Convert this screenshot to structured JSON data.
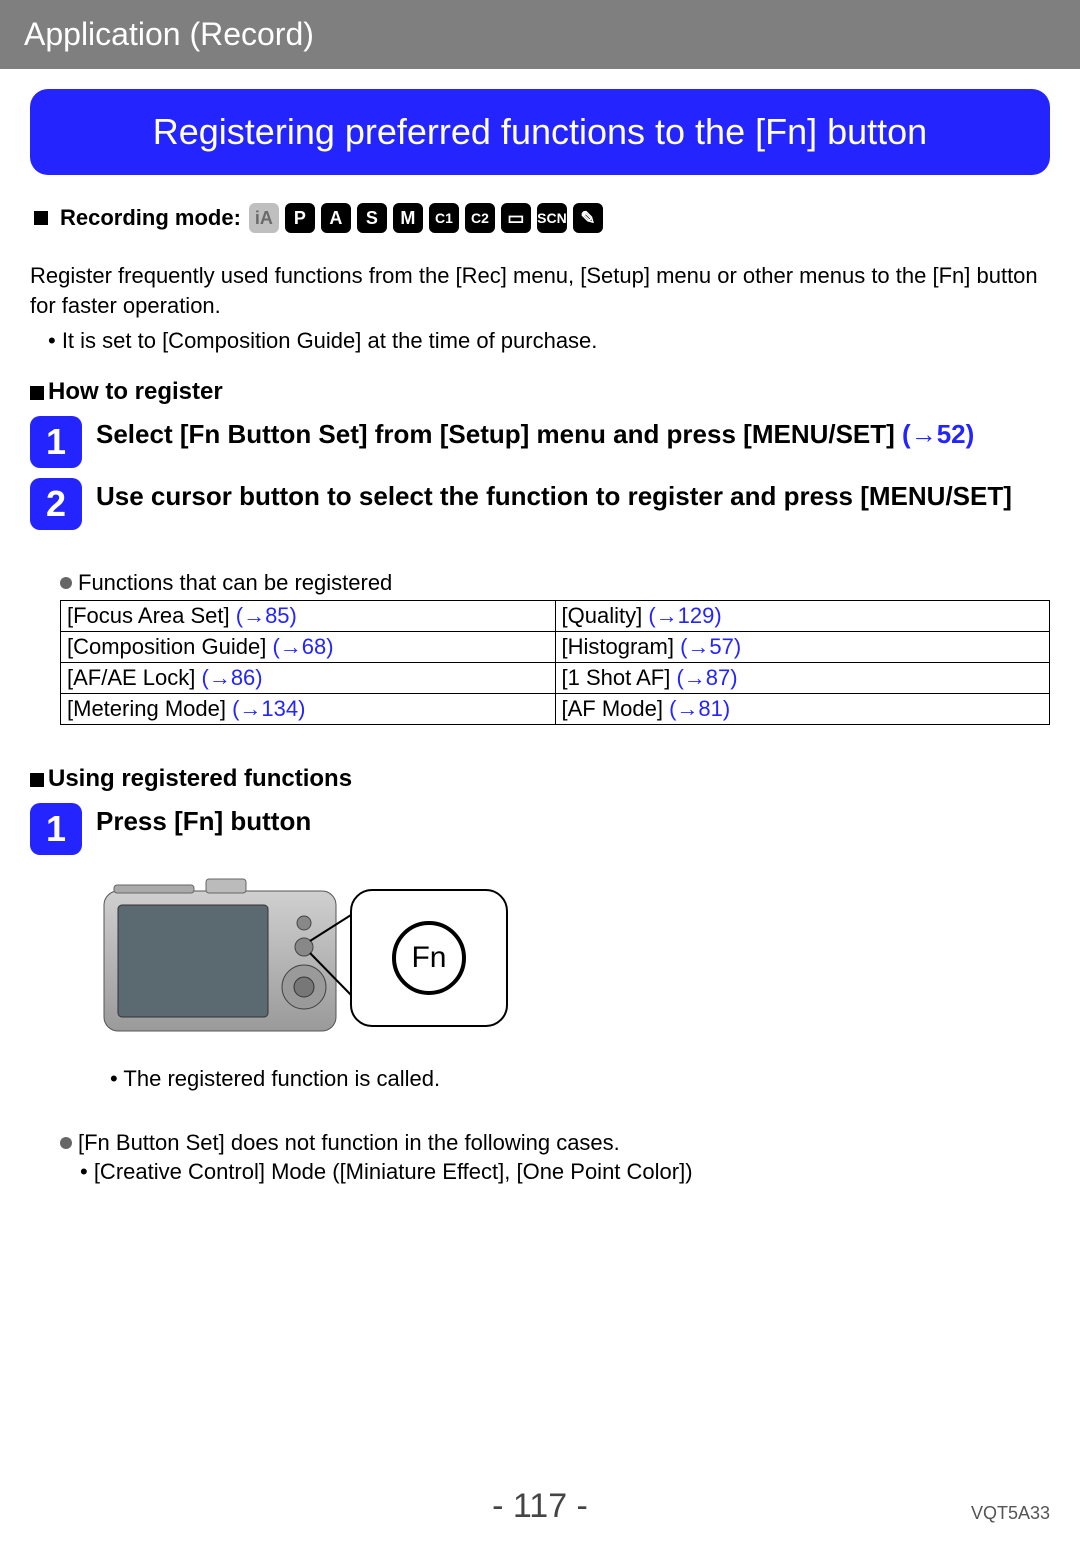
{
  "header": {
    "section_title": "Application (Record)"
  },
  "banner": {
    "title": "Registering preferred functions to the [Fn] button"
  },
  "recording_mode": {
    "label": "Recording mode:",
    "icons": [
      {
        "text": "iA",
        "ghost": true,
        "name": "mode-ia-icon"
      },
      {
        "text": "P",
        "ghost": false,
        "name": "mode-p-icon"
      },
      {
        "text": "A",
        "ghost": false,
        "name": "mode-a-icon"
      },
      {
        "text": "S",
        "ghost": false,
        "name": "mode-s-icon"
      },
      {
        "text": "M",
        "ghost": false,
        "name": "mode-m-icon"
      },
      {
        "text": "C1",
        "ghost": false,
        "name": "mode-c1-icon",
        "small": true
      },
      {
        "text": "C2",
        "ghost": false,
        "name": "mode-c2-icon",
        "small": true
      },
      {
        "text": "▭",
        "ghost": false,
        "name": "mode-panorama-icon"
      },
      {
        "text": "SCN",
        "ghost": false,
        "name": "mode-scn-icon",
        "small": true
      },
      {
        "text": "✎",
        "ghost": false,
        "name": "mode-creative-icon"
      }
    ]
  },
  "intro": {
    "paragraph": "Register frequently used functions from the [Rec] menu, [Setup] menu or other menus to the [Fn] button for faster operation.",
    "bullet": "• It is set to [Composition Guide] at the time of purchase."
  },
  "how_to_register": {
    "heading": "How to register",
    "step1": {
      "num": "1",
      "text_a": "Select [Fn Button Set] from [Setup] menu and press [MENU/SET] ",
      "link": "(→52)"
    },
    "step2": {
      "num": "2",
      "text": "Use cursor button to select the function to register and press [MENU/SET]"
    },
    "functions_label": "Functions that can be registered",
    "table": [
      [
        {
          "label": "[Focus Area Set] ",
          "link": "(→85)"
        },
        {
          "label": "[Quality] ",
          "link": "(→129)"
        }
      ],
      [
        {
          "label": "[Composition Guide] ",
          "link": "(→68)"
        },
        {
          "label": "[Histogram] ",
          "link": "(→57)"
        }
      ],
      [
        {
          "label": "[AF/AE Lock] ",
          "link": "(→86)"
        },
        {
          "label": "[1 Shot AF] ",
          "link": "(→87)"
        }
      ],
      [
        {
          "label": "[Metering Mode] ",
          "link": "(→134)"
        },
        {
          "label": "[AF Mode] ",
          "link": "(→81)"
        }
      ]
    ]
  },
  "using_registered": {
    "heading": "Using registered functions",
    "step1": {
      "num": "1",
      "text": "Press [Fn] button"
    },
    "fn_label": "Fn",
    "result": "• The registered function is called."
  },
  "notes": {
    "line1": "[Fn Button Set] does not function in the following cases.",
    "line2": "• [Creative Control] Mode ([Miniature Effect], [One Point Color])"
  },
  "footer": {
    "page": "- 117 -",
    "doc_code": "VQT5A33"
  }
}
